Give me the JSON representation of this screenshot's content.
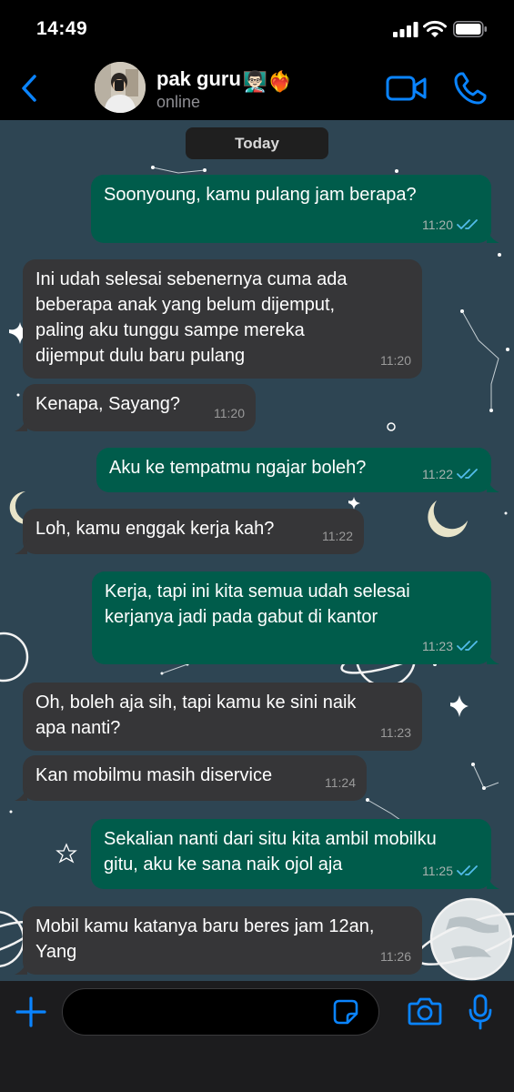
{
  "status_bar": {
    "time": "14:49"
  },
  "contact": {
    "name": "pak guru",
    "name_emoji": "👨🏻‍🏫❤️‍🔥",
    "status": "online"
  },
  "chat": {
    "date_label": "Today",
    "messages": [
      {
        "direction": "out",
        "text": "Soonyoung, kamu pulang jam berapa?",
        "time": "11:20",
        "read": true
      },
      {
        "direction": "in",
        "text": "Ini udah selesai sebenernya cuma ada\nbeberapa anak yang belum dijemput,\npaling aku tunggu sampe mereka\ndijemput dulu baru pulang",
        "time": "11:20"
      },
      {
        "direction": "in",
        "text": "Kenapa, Sayang?",
        "time": "11:20"
      },
      {
        "direction": "out",
        "text": "Aku ke tempatmu ngajar boleh?",
        "time": "11:22",
        "read": true
      },
      {
        "direction": "in",
        "text": "Loh, kamu enggak kerja kah?",
        "time": "11:22"
      },
      {
        "direction": "out",
        "text": "Kerja, tapi ini kita semua udah selesai\nkerjanya jadi pada gabut di kantor",
        "time": "11:23",
        "read": true
      },
      {
        "direction": "in",
        "text": "Oh, boleh aja sih, tapi kamu ke sini naik\napa nanti?",
        "time": "11:23"
      },
      {
        "direction": "in",
        "text": "Kan mobilmu masih diservice",
        "time": "11:24"
      },
      {
        "direction": "out",
        "text": "Sekalian nanti dari situ kita ambil mobilku\ngitu, aku ke sana naik ojol aja",
        "time": "11:25",
        "read": true
      },
      {
        "direction": "in",
        "text": "Mobil kamu katanya baru beres jam 12an,\nYang",
        "time": "11:26"
      }
    ]
  },
  "composer": {
    "value": "",
    "placeholder": ""
  },
  "icons": {
    "back": "chevron-left-icon",
    "video": "video-camera-icon",
    "call": "phone-icon",
    "plus": "plus-icon",
    "sticker": "sticker-icon",
    "camera": "camera-icon",
    "mic": "microphone-icon",
    "read_receipt": "double-check-icon"
  },
  "colors": {
    "accent": "#0a84ff",
    "outgoing_bubble": "#005c4b",
    "incoming_bubble": "#363638",
    "wallpaper": "#2e4553",
    "read_tick": "#53bdeb"
  }
}
